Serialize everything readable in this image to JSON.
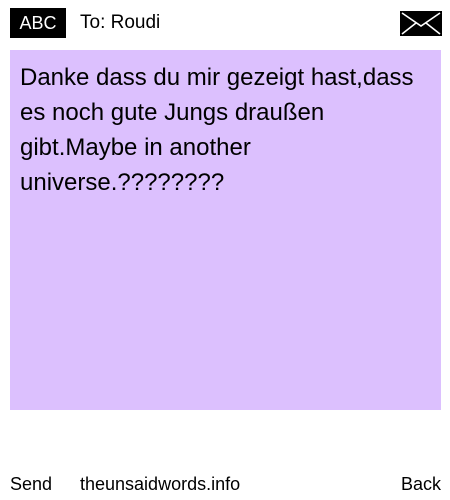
{
  "header": {
    "mode_label": "ABC",
    "recipient_label": "To: Roudi",
    "envelope_icon": "envelope-icon"
  },
  "message": {
    "text": "Danke dass du mir gezeigt hast,dass es noch gute Jungs draußen gibt.Maybe in another universe.????????",
    "background_color": "#dcc0fe"
  },
  "footer": {
    "send_label": "Send",
    "site_label": "theunsaidwords.info",
    "back_label": "Back"
  }
}
